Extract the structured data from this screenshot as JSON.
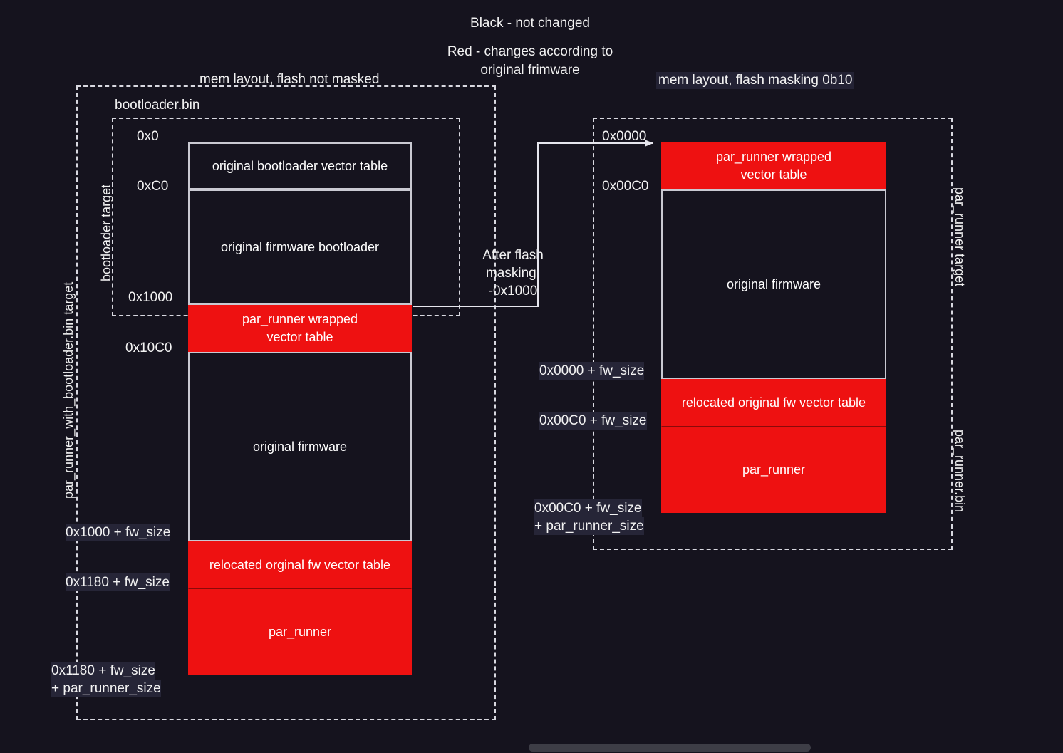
{
  "legend": {
    "line1": "Black - not changed",
    "line2": "Red - changes according to",
    "line3": "original frimware"
  },
  "left_diagram": {
    "title": "mem layout, flash not masked",
    "outer_container_label": "par_runner_with_bootloader.bin target",
    "bootloader_target_label": "bootloader target",
    "bootloader_bin_label": "bootloader.bin",
    "addresses": {
      "a0": "0x0",
      "a1": "0xC0",
      "a2": "0x1000",
      "a3": "0x10C0",
      "a4": "0x1000 + fw_size",
      "a5": "0x1180 + fw_size",
      "a6_line1": "0x1180 + fw_size",
      "a6_line2": "+ par_runner_size"
    },
    "regions": [
      {
        "name": "original bootloader vector table",
        "color": "black"
      },
      {
        "name": "original firmware bootloader",
        "color": "black"
      },
      {
        "name": "par_runner wrapped\nvector table",
        "color": "red"
      },
      {
        "name": "original firmware",
        "color": "black"
      },
      {
        "name": "relocated orginal fw vector table",
        "color": "red"
      },
      {
        "name": "par_runner",
        "color": "red"
      }
    ]
  },
  "transition": {
    "annotation": "After flash\nmasking,\n-0x1000"
  },
  "right_diagram": {
    "title": "mem layout, flash masking 0b10",
    "par_runner_target_label": "par_runner target",
    "par_runner_bin_label": "par_runner.bin",
    "addresses": {
      "b0": "0x0000",
      "b1": "0x00C0",
      "b2": "0x0000 + fw_size",
      "b3": "0x00C0 + fw_size",
      "b4_line1": "0x00C0 + fw_size",
      "b4_line2": "+ par_runner_size"
    },
    "regions": [
      {
        "name": "par_runner wrapped\nvector table",
        "color": "red"
      },
      {
        "name": "original firmware",
        "color": "black"
      },
      {
        "name": "relocated original fw vector table",
        "color": "red"
      },
      {
        "name": "par_runner",
        "color": "red"
      }
    ]
  },
  "colors": {
    "background": "#15131e",
    "red_accent": "#ee1111",
    "stroke": "#c9c9d2",
    "text": "#f2f2f2"
  }
}
